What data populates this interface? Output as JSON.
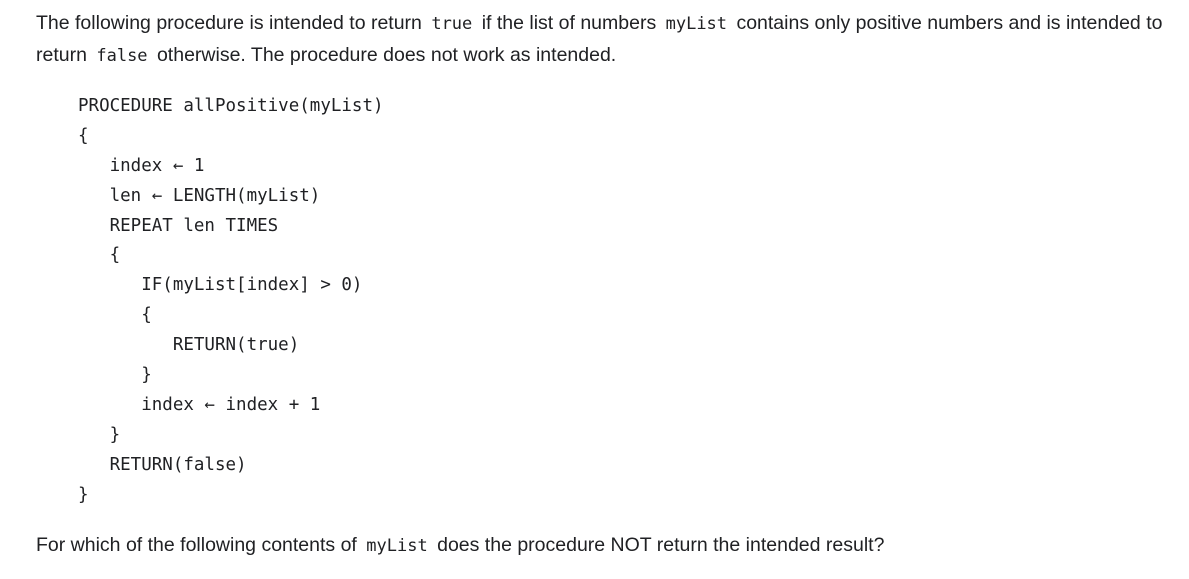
{
  "intro": {
    "t1": "The following procedure is intended to return ",
    "c1": "true",
    "t2": " if the list of numbers ",
    "c2": "myList",
    "t3": " contains only positive numbers and is intended to return ",
    "c3": "false",
    "t4": " otherwise. The procedure does not work as intended."
  },
  "code_lines": [
    "PROCEDURE allPositive(myList)",
    "{",
    "   index ← 1",
    "   len ← LENGTH(myList)",
    "   REPEAT len TIMES",
    "   {",
    "      IF(myList[index] > 0)",
    "      {",
    "         RETURN(true)",
    "      }",
    "      index ← index + 1",
    "   }",
    "   RETURN(false)",
    "}"
  ],
  "question": {
    "t1": "For which of the following contents of ",
    "c1": "myList",
    "t2": " does the procedure NOT return the intended result?"
  }
}
